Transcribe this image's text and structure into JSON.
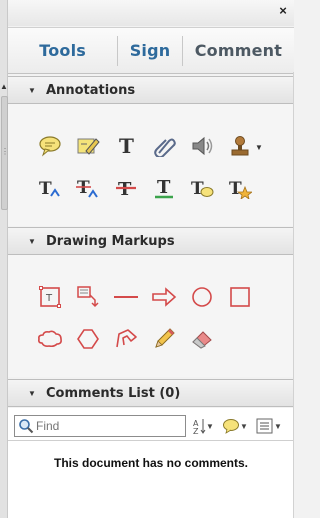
{
  "window": {
    "close_glyph": "×"
  },
  "tabs": [
    {
      "label": "Tools"
    },
    {
      "label": "Sign"
    },
    {
      "label": "Comment"
    }
  ],
  "sections": {
    "annotations": {
      "title": "Annotations",
      "tools": [
        "sticky-note-icon",
        "highlight-text-icon",
        "add-text-icon",
        "attach-file-icon",
        "record-audio-icon",
        "stamp-icon",
        "insert-text-icon",
        "replace-text-icon",
        "strikethrough-icon",
        "underline-icon",
        "text-comment-icon",
        "text-correction-icon"
      ]
    },
    "drawing_markups": {
      "title": "Drawing Markups",
      "tools": [
        "text-box-icon",
        "callout-icon",
        "line-icon",
        "arrow-icon",
        "oval-icon",
        "rectangle-icon",
        "cloud-icon",
        "polygon-icon",
        "connected-lines-icon",
        "pencil-icon",
        "eraser-icon"
      ]
    },
    "comments_list": {
      "title": "Comments List (0)",
      "search_placeholder": "Find",
      "empty_message": "This document has no comments."
    }
  },
  "colors": {
    "tab_active": "#2e6a9c",
    "tab_inactive": "#4d5963",
    "markup_red": "#d44a4a"
  }
}
